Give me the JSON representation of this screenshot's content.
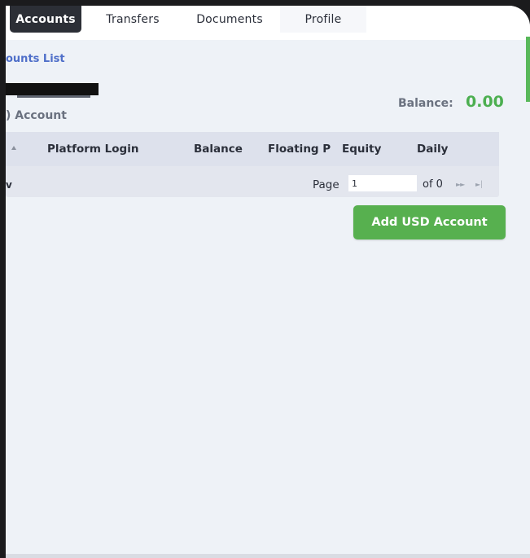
{
  "nav": {
    "tabs": [
      {
        "label": "Accounts",
        "active": true
      },
      {
        "label": "Transfers",
        "active": false
      },
      {
        "label": "Documents",
        "active": false
      },
      {
        "label": "Profile",
        "active": false
      }
    ]
  },
  "breadcrumb": "ounts List",
  "account_title": ") Account",
  "balance": {
    "label": "Balance:",
    "value": "0.00",
    "value_color": "#4caf50"
  },
  "table": {
    "columns": [
      "Platform Login",
      "Balance",
      "Floating P",
      "Equity",
      "Daily"
    ],
    "footer_left": "v",
    "page_label": "Page",
    "page_value": "1",
    "of_label": "of 0",
    "next_icon": "next-page-icon",
    "last_icon": "last-page-icon"
  },
  "add_button": {
    "label": "Add USD Account",
    "color": "#57b04f"
  },
  "colors": {
    "accent": "#4f6fc9",
    "active_tab": "#2c2f36"
  }
}
